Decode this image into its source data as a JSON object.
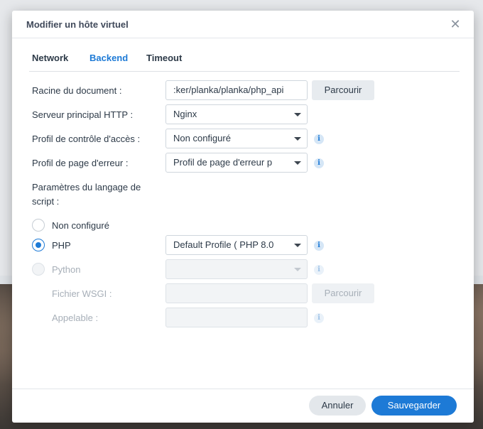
{
  "dialog": {
    "title": "Modifier un hôte virtuel",
    "close_symbol": "✕"
  },
  "tabs": [
    {
      "label": "Network",
      "active": false
    },
    {
      "label": "Backend",
      "active": true
    },
    {
      "label": "Timeout",
      "active": false
    }
  ],
  "form": {
    "document_root": {
      "label": "Racine du document :",
      "value": ":ker/planka/planka/php_api",
      "browse_label": "Parcourir"
    },
    "http_server": {
      "label": "Serveur principal HTTP :",
      "value": "Nginx"
    },
    "access_profile": {
      "label": "Profil de contrôle d'accès :",
      "value": "Non configuré"
    },
    "error_page_profile": {
      "label": "Profil de page d'erreur :",
      "value": "Profil de page d'erreur p"
    },
    "script_language": {
      "label_line1": "Paramètres du langage de",
      "label_line2": "script :"
    },
    "options": {
      "none": {
        "label": "Non configuré",
        "checked": false
      },
      "php": {
        "label": "PHP",
        "checked": true,
        "profile": "Default Profile ( PHP 8.0"
      },
      "python": {
        "label": "Python",
        "checked": false,
        "disabled": true,
        "profile": ""
      }
    },
    "wsgi_file": {
      "label": "Fichier WSGI :",
      "value": "",
      "browse_label": "Parcourir"
    },
    "callable": {
      "label": "Appelable :",
      "value": ""
    }
  },
  "footer": {
    "cancel_label": "Annuler",
    "save_label": "Sauvegarder"
  },
  "icons": {
    "info": "i"
  },
  "colors": {
    "accent": "#1d7ad6",
    "text": "#2d3a48",
    "disabled_text": "#a7afb8"
  }
}
